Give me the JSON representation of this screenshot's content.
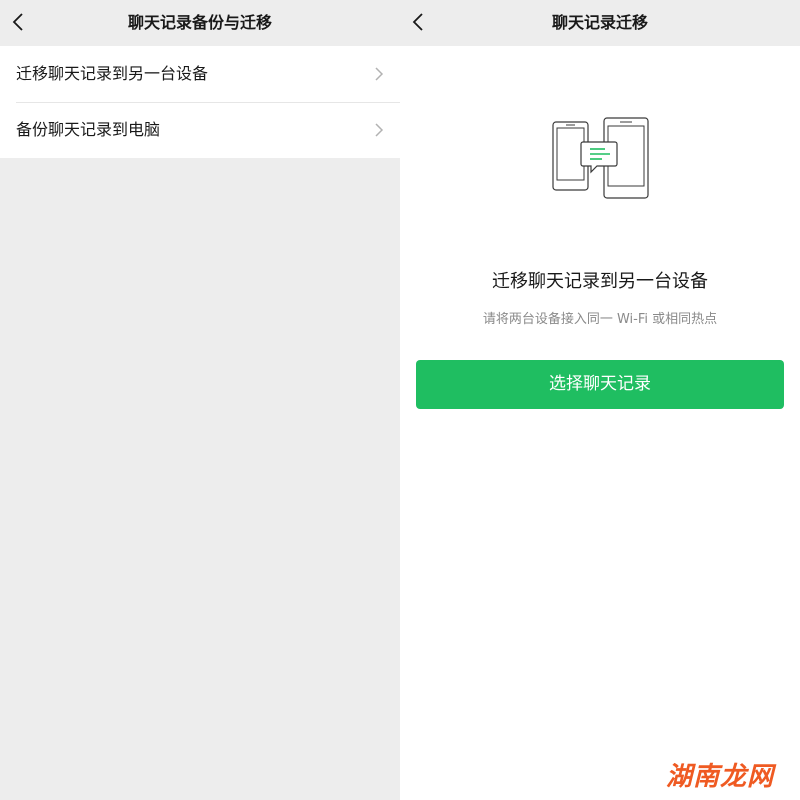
{
  "left_screen": {
    "nav": {
      "back_icon": "chevron-left-icon",
      "title": "聊天记录备份与迁移"
    },
    "menu_items": [
      {
        "label": "迁移聊天记录到另一台设备",
        "icon": "chevron-right-icon"
      },
      {
        "label": "备份聊天记录到电脑",
        "icon": "chevron-right-icon"
      }
    ]
  },
  "right_screen": {
    "nav": {
      "back_icon": "chevron-left-icon",
      "title": "聊天记录迁移"
    },
    "illustration_icon": "two-phones-transfer-icon",
    "headline": "迁移聊天记录到另一台设备",
    "hint": "请将两台设备接入同一 Wi-Fi 或相同热点",
    "primary_button": "选择聊天记录"
  },
  "watermark": "湖南龙网",
  "colors": {
    "accent_green": "#1fbe61",
    "nav_background": "#ededed",
    "watermark_orange": "#ef5a22"
  }
}
